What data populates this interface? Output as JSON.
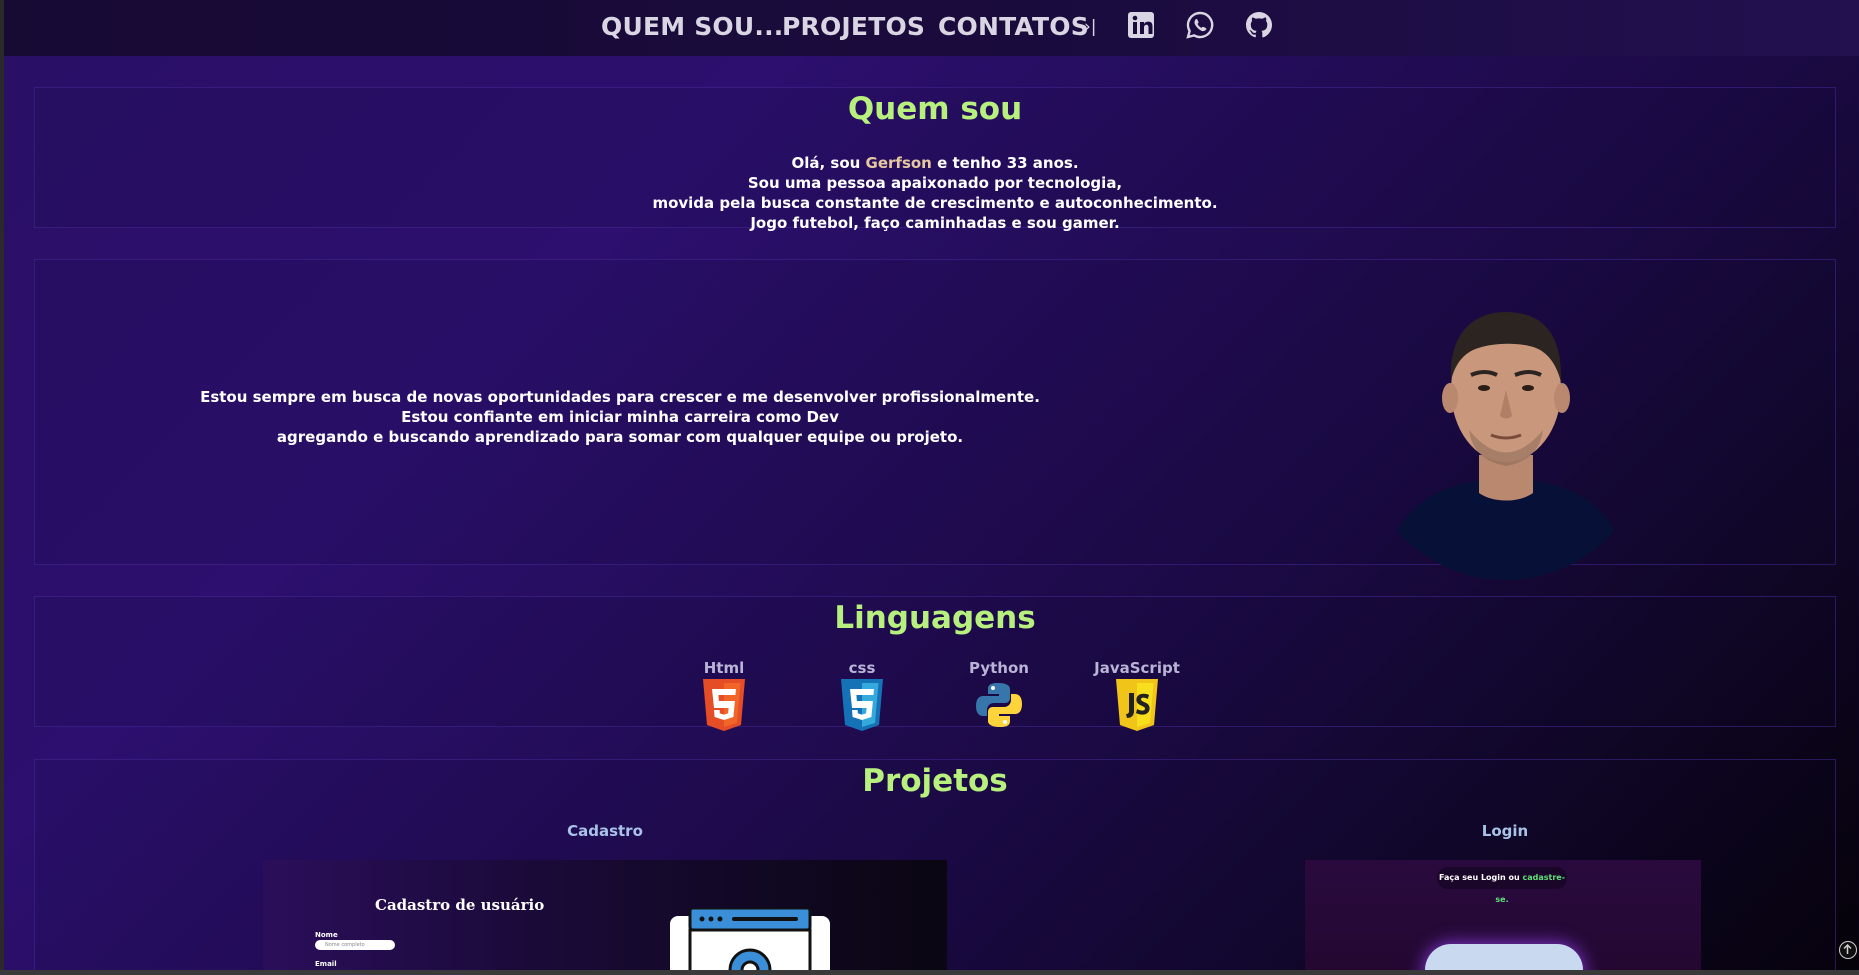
{
  "nav": {
    "links": [
      {
        "label": "QUEM SOU..."
      },
      {
        "label": "PROJETOS"
      },
      {
        "label": "CONTATOS"
      }
    ],
    "arrow": "›|",
    "icons": [
      "linkedin-icon",
      "whatsapp-icon",
      "github-icon"
    ]
  },
  "about": {
    "title": "Quem sou",
    "line1_prefix": "Olá, sou ",
    "name": "Gerfson",
    "line1_suffix": " e tenho 33 anos.",
    "line2": "Sou uma pessoa apaixonado por tecnologia,",
    "line3": "movida pela busca constante de crescimento e autoconhecimento.",
    "line4": "Jogo futebol, faço caminhadas e sou gamer."
  },
  "goals": {
    "line1": "Estou sempre em busca de novas oportunidades para crescer e me desenvolver profissionalmente.",
    "line2": "Estou confiante em iniciar minha carreira como Dev",
    "line3": "agregando e buscando aprendizado para somar com qualquer equipe ou projeto."
  },
  "languages": {
    "title": "Linguagens",
    "items": [
      {
        "label": "Html",
        "icon": "html5-icon"
      },
      {
        "label": "css",
        "icon": "css3-icon"
      },
      {
        "label": "Python",
        "icon": "python-icon"
      },
      {
        "label": "JavaScript",
        "icon": "javascript-icon"
      }
    ]
  },
  "projects": {
    "title": "Projetos",
    "cadastro": {
      "label": "Cadastro",
      "thumb_title": "Cadastro de usuário",
      "field1_label": "Nome",
      "field1_placeholder": "Nome completo",
      "field2_label": "Email"
    },
    "login": {
      "label": "Login",
      "pill_prefix": "Faça seu Login ou ",
      "pill_link": "cadastre-se."
    }
  },
  "colors": {
    "accent_green": "#b7f07d",
    "name_highlight": "#e6c9a0",
    "nav_text": "#d9d5e3",
    "background_purple": "#2c0f6e"
  }
}
